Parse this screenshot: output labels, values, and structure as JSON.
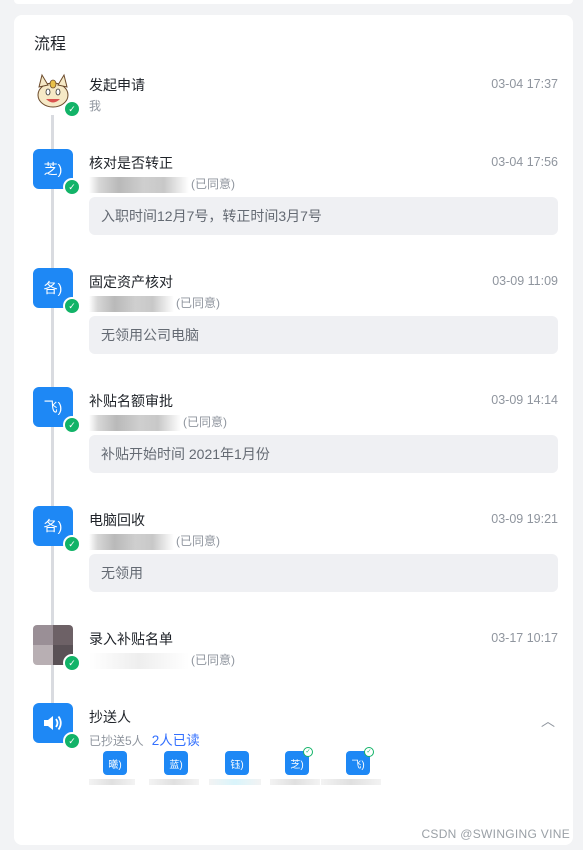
{
  "section_title": "流程",
  "steps": [
    {
      "avatar": "",
      "avatar_kind": "meowth-image",
      "name": "发起申请",
      "time": "03-04 17:37",
      "sub": "我"
    },
    {
      "avatar": "芝)",
      "name": "核对是否转正",
      "time": "03-04 17:56",
      "status": "(已同意)",
      "comment": "入职时间12月7号，转正时间3月7号"
    },
    {
      "avatar": "各)",
      "name": "固定资产核对",
      "time": "03-09 11:09",
      "status": "(已同意)",
      "comment": "无领用公司电脑"
    },
    {
      "avatar": "飞)",
      "name": "补贴名额审批",
      "time": "03-09 14:14",
      "status": "(已同意)",
      "comment": "补贴开始时间 2021年1月份"
    },
    {
      "avatar": "各)",
      "name": "电脑回收",
      "time": "03-09 19:21",
      "status": "(已同意)",
      "comment": "无领用"
    },
    {
      "avatar": "",
      "avatar_kind": "mosaic-image",
      "name": "录入补贴名单",
      "time": "03-17 10:17",
      "status": "(已同意)"
    }
  ],
  "cc": {
    "name": "抄送人",
    "sent": "已抄送5人",
    "read": "2人已读",
    "icon": "speaker-icon",
    "people": [
      "曦)",
      "蓝)",
      "钰)",
      "芝)",
      "飞)"
    ]
  },
  "watermark": "CSDN @SWINGING  VINE",
  "colors": {
    "accent": "#1e88f5",
    "check": "#12b368",
    "link": "#3370ff"
  }
}
